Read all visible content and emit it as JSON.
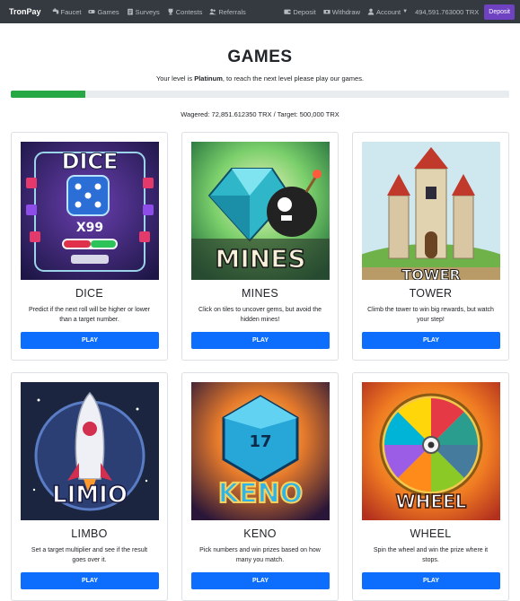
{
  "navbar": {
    "brand": "TronPay",
    "items": [
      {
        "label": "Faucet",
        "icon": "faucet-icon"
      },
      {
        "label": "Games",
        "icon": "gamepad-icon"
      },
      {
        "label": "Surveys",
        "icon": "clipboard-icon"
      },
      {
        "label": "Contests",
        "icon": "trophy-icon"
      },
      {
        "label": "Referrals",
        "icon": "users-icon"
      }
    ],
    "right": {
      "deposit": "Deposit",
      "withdraw": "Withdraw",
      "account": "Account",
      "balance": "494,591.763000 TRX",
      "deposit_button": "Deposit"
    }
  },
  "header": {
    "title": "GAMES",
    "level_prefix": "Your level is ",
    "level": "Platinum",
    "level_suffix": ", to reach the next level please play our games.",
    "progress_fraction": 0.15,
    "wagered": "Wagered: 72,851.612350 TRX / Target: 500,000 TRX"
  },
  "games": [
    {
      "title": "DICE",
      "description": "Predict if the next roll will be higher or lower than a target number.",
      "play": "PLAY",
      "art_label": "DICE",
      "art_sub": "X99"
    },
    {
      "title": "MINES",
      "description": "Click on tiles to uncover gems, but avoid the hidden mines!",
      "play": "PLAY",
      "art_label": "MINES"
    },
    {
      "title": "TOWER",
      "description": "Climb the tower to win big rewards, but watch your step!",
      "play": "PLAY",
      "art_label": "TOWER"
    },
    {
      "title": "LIMBO",
      "description": "Set a target multiplier and see if the result goes over it.",
      "play": "PLAY",
      "art_label": "LIMIO"
    },
    {
      "title": "KENO",
      "description": "Pick numbers and win prizes based on how many you match.",
      "play": "PLAY",
      "art_label": "KENO",
      "art_sub": "17"
    },
    {
      "title": "WHEEL",
      "description": "Spin the wheel and win the prize where it stops.",
      "play": "PLAY",
      "art_label": "WHEEL"
    }
  ]
}
